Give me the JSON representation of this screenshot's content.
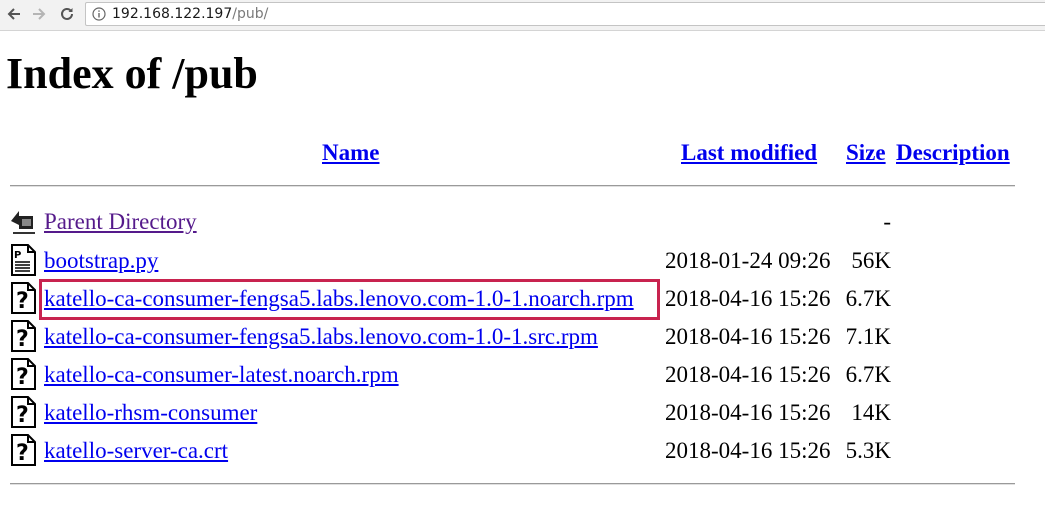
{
  "browser": {
    "url_host": "192.168.122.197",
    "url_path": "/pub/",
    "back_icon": "arrow-left-icon",
    "forward_icon": "arrow-right-icon",
    "reload_icon": "reload-icon",
    "info_icon": "info-icon"
  },
  "page": {
    "title": "Index of /pub"
  },
  "table": {
    "headers": {
      "name": "Name",
      "last_modified": "Last modified",
      "size": "Size",
      "description": "Description"
    },
    "rows": [
      {
        "icon": "back-folder-icon",
        "name": "Parent Directory",
        "modified": "",
        "size": "-"
      },
      {
        "icon": "text-file-icon",
        "name": "bootstrap.py",
        "modified": "2018-01-24 09:26",
        "size": "56K"
      },
      {
        "icon": "unknown-file-icon",
        "name": "katello-ca-consumer-fengsa5.labs.lenovo.com-1.0-1.noarch.rpm",
        "modified": "2018-04-16 15:26",
        "size": "6.7K"
      },
      {
        "icon": "unknown-file-icon",
        "name": "katello-ca-consumer-fengsa5.labs.lenovo.com-1.0-1.src.rpm",
        "modified": "2018-04-16 15:26",
        "size": "7.1K"
      },
      {
        "icon": "unknown-file-icon",
        "name": "katello-ca-consumer-latest.noarch.rpm",
        "modified": "2018-04-16 15:26",
        "size": "6.7K"
      },
      {
        "icon": "unknown-file-icon",
        "name": "katello-rhsm-consumer",
        "modified": "2018-04-16 15:26",
        "size": "14K"
      },
      {
        "icon": "unknown-file-icon",
        "name": "katello-server-ca.crt",
        "modified": "2018-04-16 15:26",
        "size": "5.3K"
      }
    ]
  },
  "annotation": {
    "highlight_color": "#c8234f"
  },
  "colors": {
    "link": "#0000ee",
    "visited_link": "#551a8b"
  }
}
